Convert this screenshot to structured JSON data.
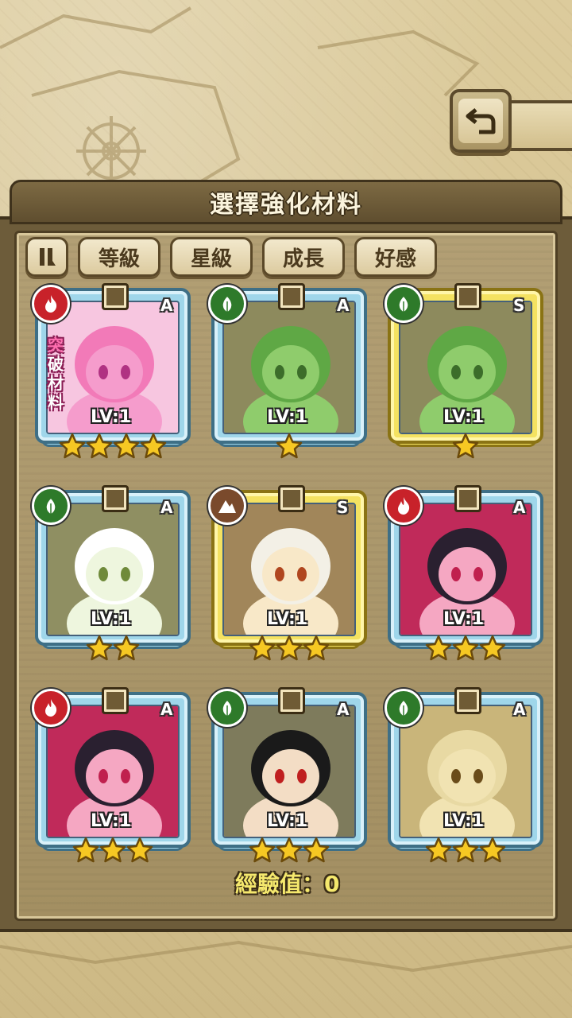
{
  "header": {
    "title": "選擇強化材料"
  },
  "filters": {
    "toggle_icon": "pause-bars-icon",
    "buttons": [
      "等級",
      "星級",
      "成長",
      "好感"
    ]
  },
  "cards": [
    {
      "element": "fire",
      "rank": "A",
      "level": "LV:1",
      "stars": 4,
      "frame": "blue",
      "art": "pink",
      "breakthrough": [
        "突",
        "破",
        "材",
        "料"
      ]
    },
    {
      "element": "leaf",
      "rank": "A",
      "level": "LV:1",
      "stars": 1,
      "frame": "blue",
      "art": "green-blob"
    },
    {
      "element": "leaf",
      "rank": "S",
      "level": "LV:1",
      "stars": 1,
      "frame": "gold",
      "art": "green-blob"
    },
    {
      "element": "leaf",
      "rank": "A",
      "level": "LV:1",
      "stars": 2,
      "frame": "blue",
      "art": "white-girl"
    },
    {
      "element": "earth",
      "rank": "S",
      "level": "LV:1",
      "stars": 3,
      "frame": "gold",
      "art": "goggle-girl"
    },
    {
      "element": "fire",
      "rank": "A",
      "level": "LV:1",
      "stars": 3,
      "frame": "blue",
      "art": "flower-girl"
    },
    {
      "element": "fire",
      "rank": "A",
      "level": "LV:1",
      "stars": 3,
      "frame": "blue",
      "art": "flower-girl"
    },
    {
      "element": "leaf",
      "rank": "A",
      "level": "LV:1",
      "stars": 3,
      "frame": "blue",
      "art": "witch-girl"
    },
    {
      "element": "leaf",
      "rank": "A",
      "level": "LV:1",
      "stars": 3,
      "frame": "blue",
      "art": "golden-girl"
    }
  ],
  "footer": {
    "exp_label": "經驗值：0"
  },
  "colors": {
    "fire": "#c8222a",
    "leaf": "#2e7a2a",
    "earth": "#7a4a2c",
    "frame_blue": "#9fd6ea",
    "frame_gold": "#f4e261",
    "star": "#f6c823"
  }
}
